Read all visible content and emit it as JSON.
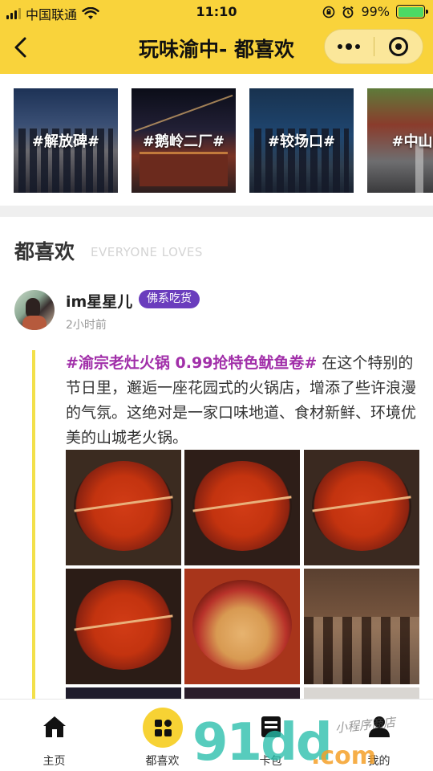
{
  "status_bar": {
    "carrier": "中国联通",
    "time": "11:10",
    "battery": "99%",
    "battery_level": 0.99,
    "icons": [
      "signal-icon",
      "wifi-icon",
      "rotation-lock-icon",
      "alarm-icon",
      "battery-icon"
    ]
  },
  "nav": {
    "title": "玩味渝中- 都喜欢",
    "back_icon": "back-arrow-icon",
    "more_icon": "more-dots-icon",
    "close_icon": "mini-program-close-icon"
  },
  "topics": [
    {
      "label": "#解放碑#"
    },
    {
      "label": "#鹅岭二厂#"
    },
    {
      "label": "#较场口#"
    },
    {
      "label": "#中山四"
    }
  ],
  "section": {
    "title": "都喜欢",
    "subtitle": "EVERYONE LOVES"
  },
  "post": {
    "username": "im星星儿",
    "badge": "佛系吃货",
    "time_ago": "2小时前",
    "tag": "#渝宗老灶火锅 0.99抢特色鱿鱼卷#",
    "body": " 在这个特别的节日里，邂逅一座花园式的火锅店，增添了些许浪漫的气氛。这绝对是一家口味地道、食材新鲜、环境优美的山城老火锅。",
    "photo_count": 9
  },
  "tabbar": {
    "tabs": [
      {
        "label": "主页",
        "icon": "home-icon"
      },
      {
        "label": "都喜欢",
        "icon": "grid-icon"
      },
      {
        "label": "卡包",
        "icon": "card-icon"
      },
      {
        "label": "我的",
        "icon": "user-icon"
      }
    ],
    "active_index": 1
  },
  "watermark": {
    "digits": "91dd",
    "domain": ".com",
    "handwriting": "小程序商店"
  },
  "colors": {
    "accent_yellow": "#f9d33b",
    "badge_purple": "#6a3dbd",
    "tag_magenta": "#a12fa9",
    "battery_green": "#4cd964"
  }
}
